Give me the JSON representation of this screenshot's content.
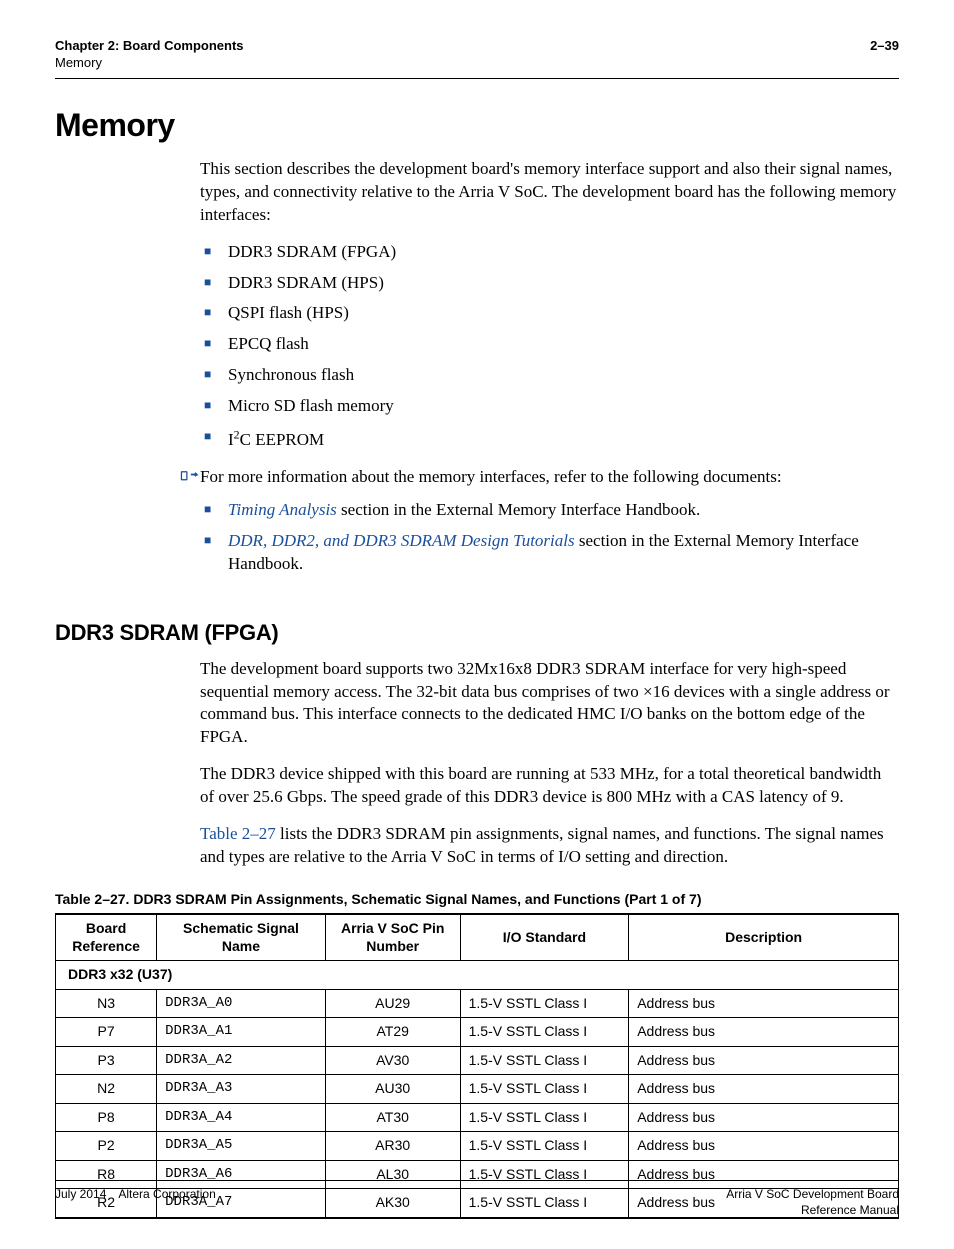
{
  "header": {
    "chapter_line": "Chapter 2: Board Components",
    "sub_line": "Memory",
    "page_num": "2–39"
  },
  "section_title": "Memory",
  "intro_para": "This section describes the development board's memory interface support and also their signal names, types, and connectivity relative to the Arria V SoC. The development board has the following memory interfaces:",
  "mem_list": [
    "DDR3 SDRAM (FPGA)",
    "DDR3 SDRAM (HPS)",
    "QSPI flash (HPS)",
    "EPCQ flash",
    "Synchronous flash",
    "Micro SD flash memory"
  ],
  "i2c_label_prefix": "I",
  "i2c_label_sup": "2",
  "i2c_label_suffix": "C EEPROM",
  "more_info_intro": "For more information about the memory interfaces, refer to the following documents:",
  "ref_items": [
    {
      "link": "Timing Analysis",
      "tail": " section in the External Memory Interface Handbook."
    },
    {
      "link": "DDR, DDR2, and DDR3 SDRAM Design Tutorials",
      "tail": " section in the External Memory Interface Handbook."
    }
  ],
  "subsection_title": "DDR3 SDRAM (FPGA)",
  "ddr3_para1": "The development board supports two 32Mx16x8 DDR3 SDRAM interface for very high-speed sequential memory access. The 32-bit data bus comprises of two ×16 devices with a single address or command bus. This interface connects to the dedicated HMC I/O banks on the bottom edge of the FPGA.",
  "ddr3_para2": "The DDR3 device shipped with this board are running at 533 MHz, for a total theoretical bandwidth of over 25.6 Gbps. The speed grade of this DDR3 device is 800 MHz with a CAS latency of 9.",
  "table_ref": "Table 2–27",
  "ddr3_para3_tail": " lists the DDR3 SDRAM pin assignments, signal names, and functions. The signal names and types are relative to the Arria V SoC in terms of I/O setting and direction.",
  "table_caption": "Table 2–27. DDR3 SDRAM Pin Assignments, Schematic Signal Names, and Functions (Part 1 of 7)",
  "table_headers": {
    "boardref": "Board Reference",
    "signame": "Schematic Signal Name",
    "pinnum": "Arria V SoC Pin Number",
    "iostd": "I/O Standard",
    "desc": "Description"
  },
  "table_group": "DDR3 x32 (U37)",
  "table_rows": [
    {
      "boardref": "N3",
      "signame": "DDR3A_A0",
      "pinnum": "AU29",
      "iostd": "1.5-V SSTL Class I",
      "desc": "Address bus"
    },
    {
      "boardref": "P7",
      "signame": "DDR3A_A1",
      "pinnum": "AT29",
      "iostd": "1.5-V SSTL Class I",
      "desc": "Address bus"
    },
    {
      "boardref": "P3",
      "signame": "DDR3A_A2",
      "pinnum": "AV30",
      "iostd": "1.5-V SSTL Class I",
      "desc": "Address bus"
    },
    {
      "boardref": "N2",
      "signame": "DDR3A_A3",
      "pinnum": "AU30",
      "iostd": "1.5-V SSTL Class I",
      "desc": "Address bus"
    },
    {
      "boardref": "P8",
      "signame": "DDR3A_A4",
      "pinnum": "AT30",
      "iostd": "1.5-V SSTL Class I",
      "desc": "Address bus"
    },
    {
      "boardref": "P2",
      "signame": "DDR3A_A5",
      "pinnum": "AR30",
      "iostd": "1.5-V SSTL Class I",
      "desc": "Address bus"
    },
    {
      "boardref": "R8",
      "signame": "DDR3A_A6",
      "pinnum": "AL30",
      "iostd": "1.5-V SSTL Class I",
      "desc": "Address bus"
    },
    {
      "boardref": "R2",
      "signame": "DDR3A_A7",
      "pinnum": "AK30",
      "iostd": "1.5-V SSTL Class I",
      "desc": "Address bus"
    }
  ],
  "footer": {
    "left": "July 2014 Altera Corporation",
    "right_line1": "Arria V SoC Development Board",
    "right_line2": "Reference Manual"
  }
}
